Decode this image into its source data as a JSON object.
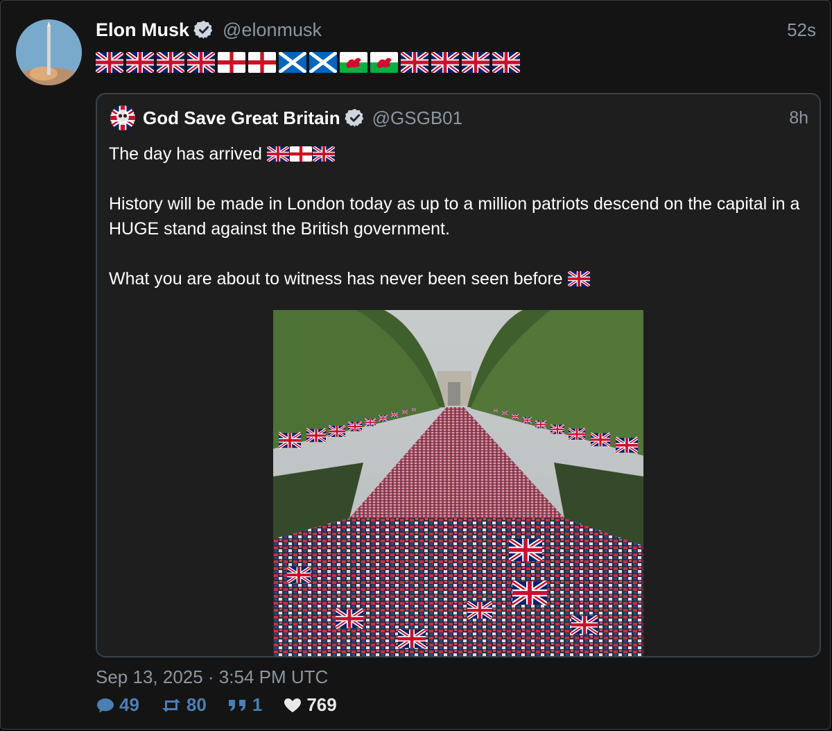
{
  "author": {
    "name": "Elon Musk",
    "handle": "@elonmusk",
    "time": "52s"
  },
  "flags": [
    "uk",
    "uk",
    "uk",
    "uk",
    "england",
    "england",
    "scotland",
    "scotland",
    "wales",
    "wales",
    "uk",
    "uk",
    "uk",
    "uk"
  ],
  "quote": {
    "name": "God Save Great Britain",
    "handle": "@GSGB01",
    "time": "8h",
    "line1": "The day has arrived",
    "line1_flags": [
      "uk",
      "england",
      "uk"
    ],
    "line2": "History will be made in London today as up to a million patriots descend on the capital in a HUGE stand against the British government.",
    "line3": "What you are about to witness has never been seen before",
    "line3_flags": [
      "uk"
    ]
  },
  "footer": {
    "date": "Sep 13, 2025 · 3:54 PM UTC",
    "replies": "49",
    "retweets": "80",
    "quotes": "1",
    "likes": "769"
  },
  "colors": {
    "background": "#141414",
    "muted": "#8d96a0",
    "stat_blue": "#4a7fb3",
    "uk_blue": "#012169",
    "uk_red": "#C8102E"
  }
}
